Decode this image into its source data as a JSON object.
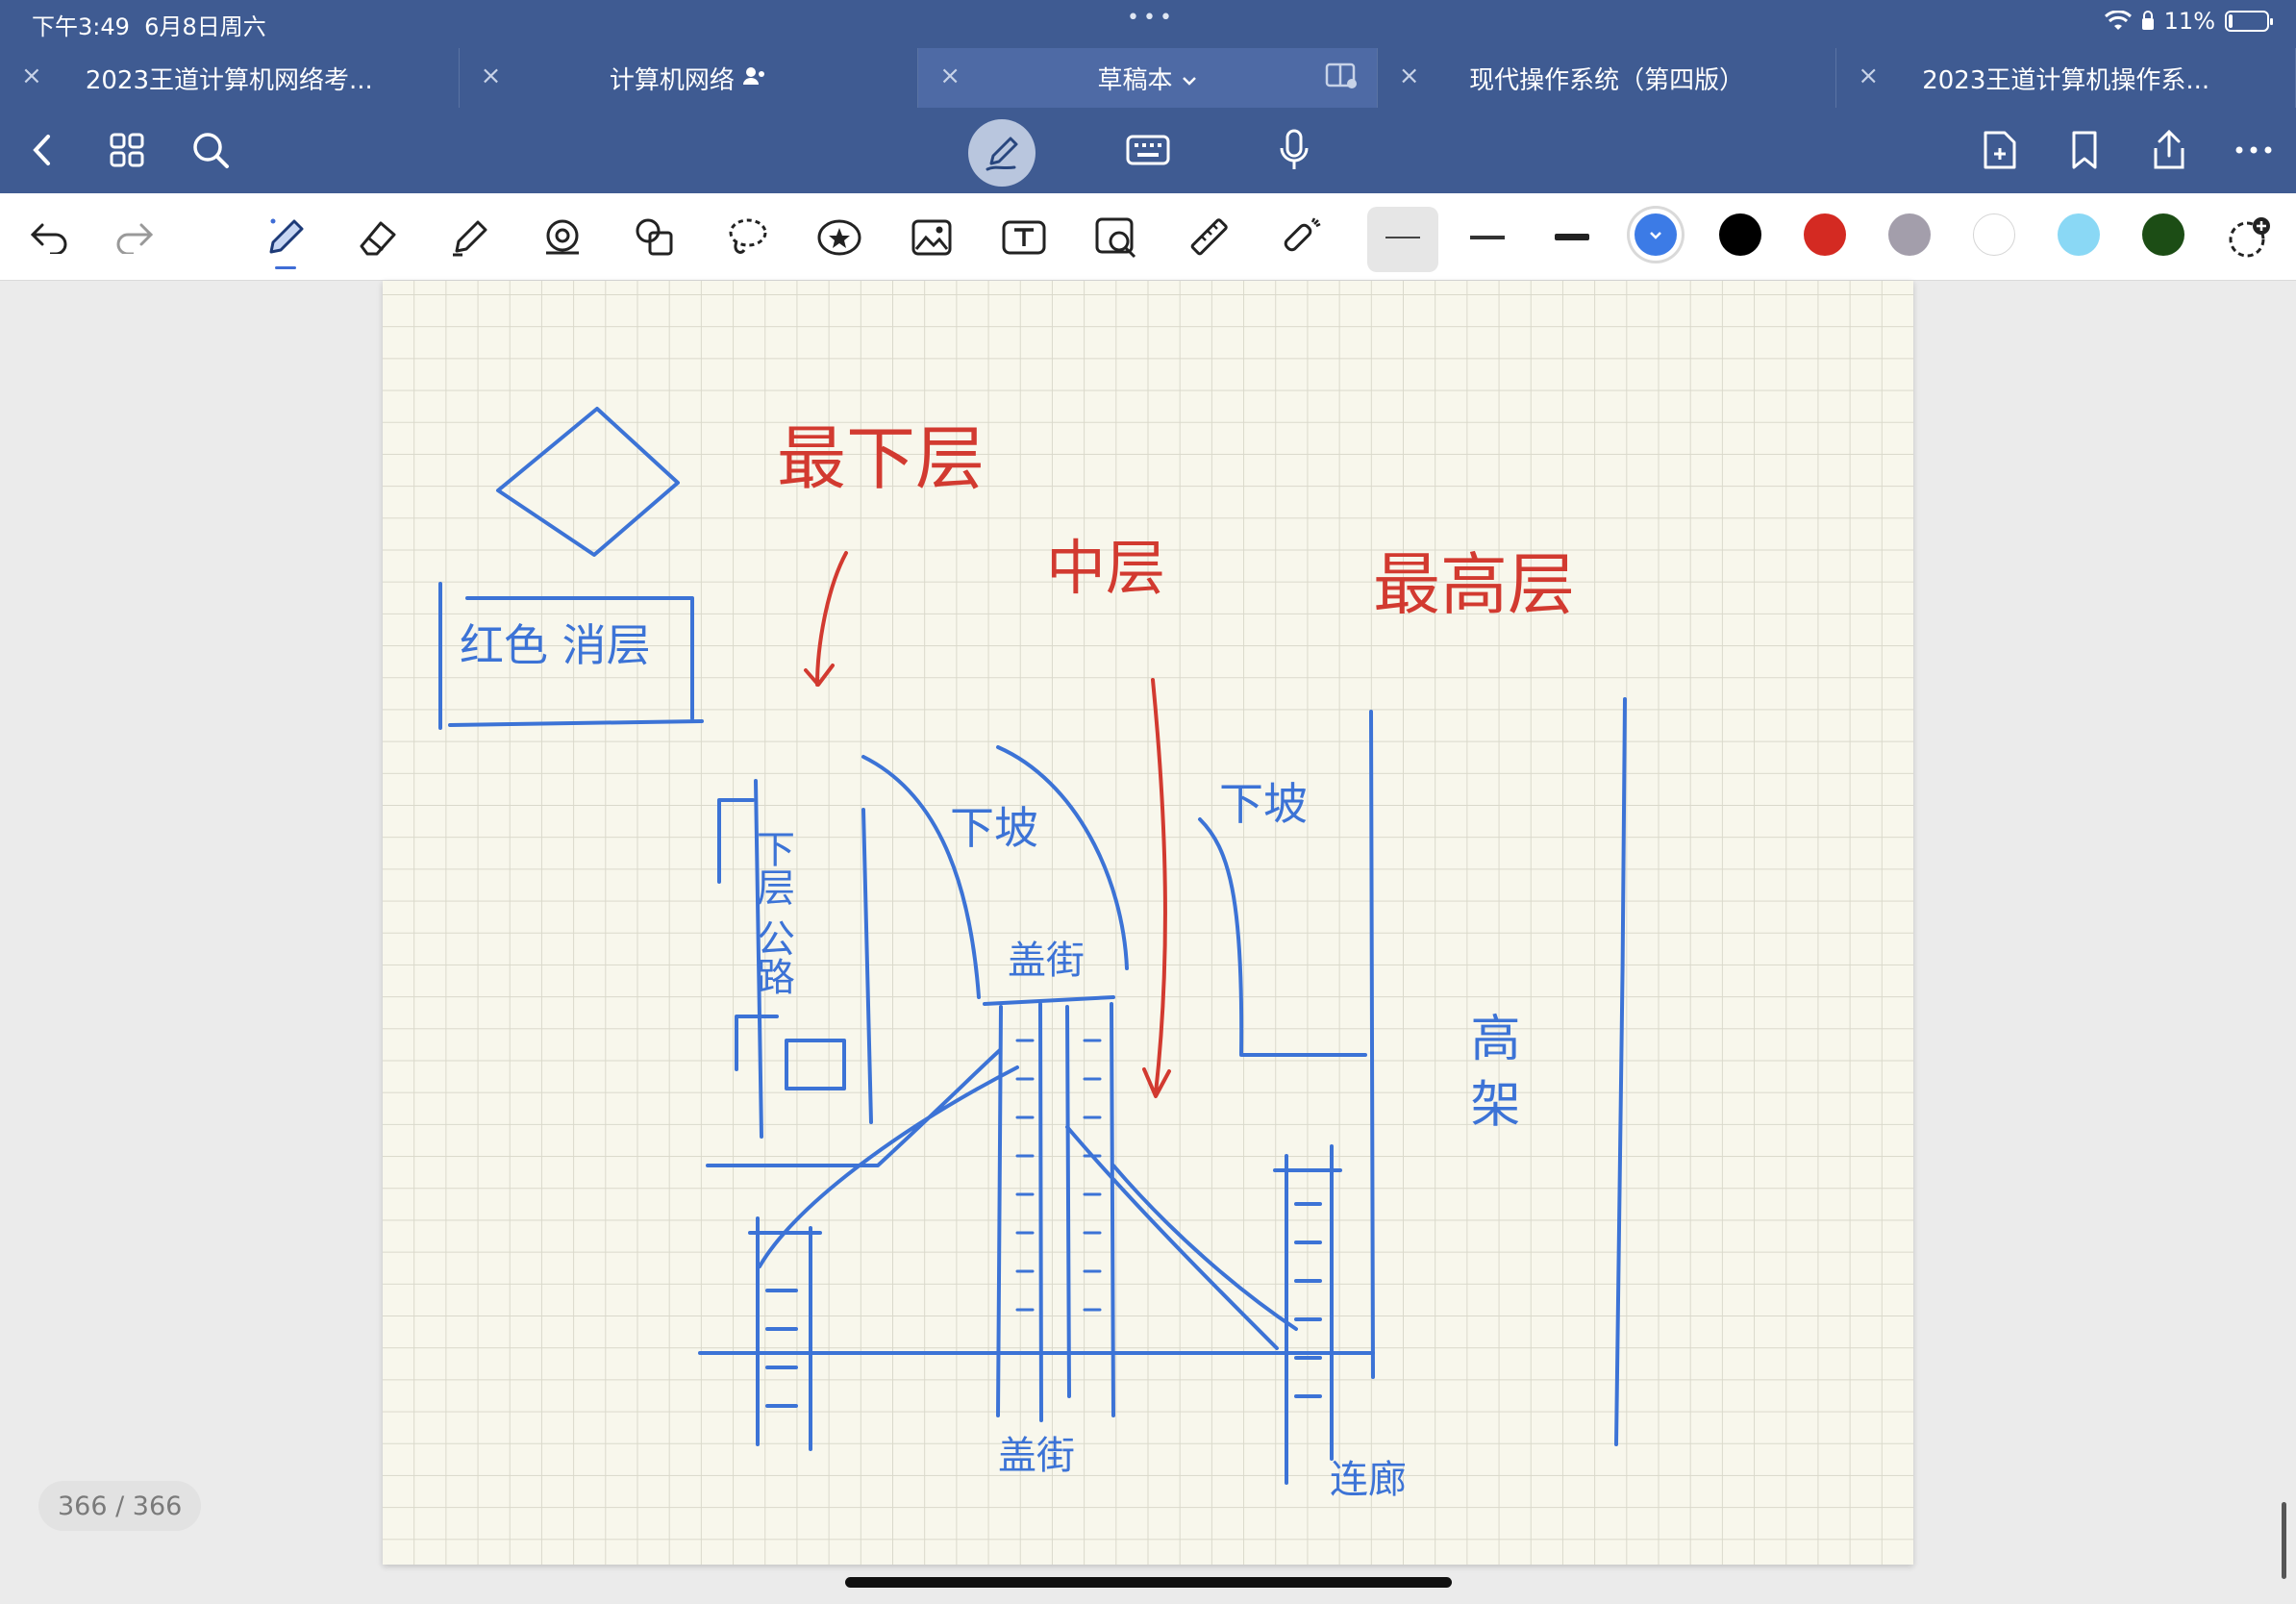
{
  "status_bar": {
    "time": "下午3:49",
    "date": "6月8日周六",
    "battery": "11%",
    "battery_level": 0.11
  },
  "tabs": [
    {
      "label": "2023王道计算机网络考...",
      "active": false
    },
    {
      "label": "计算机网络",
      "active": false
    },
    {
      "label": "草稿本",
      "active": true
    },
    {
      "label": "现代操作系统（第四版）",
      "active": false
    },
    {
      "label": "2023王道计算机操作系...",
      "active": false
    }
  ],
  "navbar": {
    "left_icons": [
      "back-icon",
      "grid-icon",
      "search-icon"
    ],
    "center_icons": [
      "pen-mode-icon",
      "keyboard-icon",
      "microphone-icon"
    ],
    "right_icons": [
      "add-page-icon",
      "bookmark-icon",
      "share-icon",
      "more-icon"
    ]
  },
  "toolbar": {
    "tools": [
      "undo",
      "redo",
      "pen",
      "eraser",
      "highlighter",
      "shapes",
      "elements",
      "lasso",
      "sticker",
      "image",
      "text",
      "camera",
      "ruler",
      "laser-pointer"
    ],
    "selected_tool": "pen",
    "colors": [
      "#3c7be6",
      "#000000",
      "#d42a22",
      "#a39eab",
      "#ffffff",
      "#8ad8f5",
      "#1c4d15"
    ],
    "selected_color": "#3c7be6"
  },
  "handwriting": {
    "legend_box": "红色 消层",
    "bottom_layer": "最下层",
    "middle_layer": "中层",
    "top_layer": "最高层",
    "lower_road": "下层 公路",
    "ramp_left": "下坡",
    "ramp_right": "下坡",
    "walkway_top": "盖街",
    "walkway_bottom": "盖街",
    "elevated": "高 架",
    "connector": "连廊"
  },
  "page_counter": "366 / 366"
}
